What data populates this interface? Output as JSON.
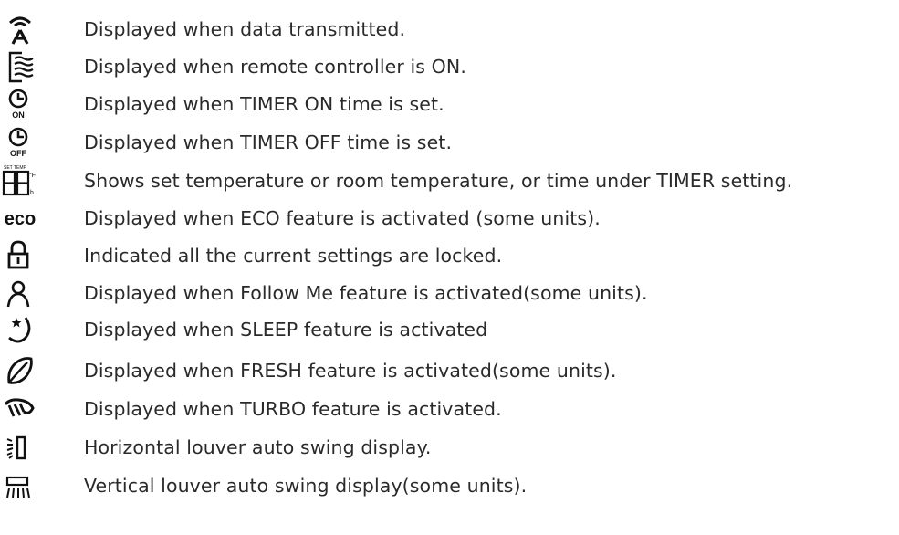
{
  "legend": {
    "items": [
      {
        "icon": "signal-transmit-icon",
        "text": "Displayed when data transmitted."
      },
      {
        "icon": "remote-on-icon",
        "text": "Displayed when remote controller is ON."
      },
      {
        "icon": "timer-on-icon",
        "text": "Displayed when TIMER ON time is set.",
        "icon_label": "ON"
      },
      {
        "icon": "timer-off-icon",
        "text": "Displayed when TIMER OFF time is set.",
        "icon_label": "OFF"
      },
      {
        "icon": "temperature-display-icon",
        "text": "Shows set temperature or room temperature, or time under TIMER setting.",
        "icon_label": "SET TEMP",
        "icon_unit_f": "°F",
        "icon_unit_h": "h"
      },
      {
        "icon": "eco-icon",
        "text": "Displayed when ECO feature is activated (some units).",
        "icon_label": "eco"
      },
      {
        "icon": "lock-icon",
        "text": "Indicated all the current settings are locked."
      },
      {
        "icon": "follow-me-icon",
        "text": "Displayed when Follow Me feature is activated(some units)."
      },
      {
        "icon": "sleep-icon",
        "text": "Displayed when SLEEP feature is activated"
      },
      {
        "icon": "fresh-leaf-icon",
        "text": "Displayed when FRESH feature is activated(some units)."
      },
      {
        "icon": "turbo-icon",
        "text": "Displayed when TURBO feature is activated."
      },
      {
        "icon": "horizontal-swing-icon",
        "text": "Horizontal louver auto swing display."
      },
      {
        "icon": "vertical-swing-icon",
        "text": "Vertical louver auto swing display(some units)."
      }
    ]
  }
}
